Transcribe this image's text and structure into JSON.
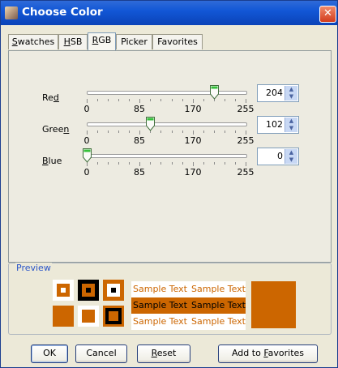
{
  "window": {
    "title": "Choose Color",
    "close_glyph": "✕"
  },
  "tabs": [
    {
      "label": "Swatches",
      "underline": "S",
      "rest": "watches"
    },
    {
      "label": "HSB",
      "underline": "H",
      "rest": "SB"
    },
    {
      "label": "RGB",
      "underline": "R",
      "rest": "GB",
      "active": true
    },
    {
      "label": "Picker",
      "underline": "",
      "rest": "Picker"
    },
    {
      "label": "Favorites",
      "underline": "",
      "rest": "Favorites"
    }
  ],
  "sliders": [
    {
      "label_pre": "Re",
      "label_u": "d",
      "label_post": "",
      "value": 204
    },
    {
      "label_pre": "Gree",
      "label_u": "n",
      "label_post": "",
      "value": 102
    },
    {
      "label_pre": "",
      "label_u": "B",
      "label_post": "lue",
      "value": 0
    }
  ],
  "slider_ticks": [
    "0",
    "85",
    "170",
    "255"
  ],
  "slider_max": 255,
  "spinner_icon": "up-down-arrows-icon",
  "preview": {
    "title": "Preview",
    "sample_text": "Sample Text",
    "color": "#cc6600"
  },
  "buttons": {
    "ok": "OK",
    "cancel": "Cancel",
    "reset_u": "R",
    "reset_rest": "eset",
    "fav_pre": "Add to ",
    "fav_u": "F",
    "fav_rest": "avorites"
  }
}
